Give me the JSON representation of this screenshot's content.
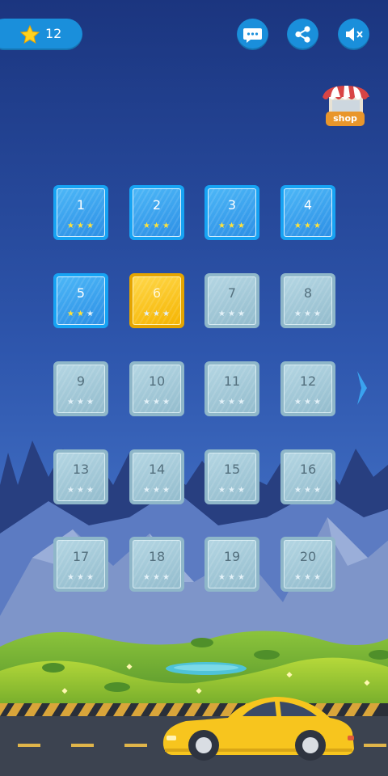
{
  "hud": {
    "star_total": "12"
  },
  "shop": {
    "label": "shop"
  },
  "levels": [
    {
      "number": "1",
      "state": "unlocked",
      "stars": [
        true,
        true,
        true
      ]
    },
    {
      "number": "2",
      "state": "unlocked",
      "stars": [
        true,
        true,
        true
      ]
    },
    {
      "number": "3",
      "state": "unlocked",
      "stars": [
        true,
        true,
        true
      ]
    },
    {
      "number": "4",
      "state": "unlocked",
      "stars": [
        true,
        true,
        true
      ]
    },
    {
      "number": "5",
      "state": "unlocked",
      "stars": [
        true,
        true,
        false
      ]
    },
    {
      "number": "6",
      "state": "current",
      "stars": [
        false,
        false,
        false
      ]
    },
    {
      "number": "7",
      "state": "locked",
      "stars": [
        false,
        false,
        false
      ]
    },
    {
      "number": "8",
      "state": "locked",
      "stars": [
        false,
        false,
        false
      ]
    },
    {
      "number": "9",
      "state": "locked",
      "stars": [
        false,
        false,
        false
      ]
    },
    {
      "number": "10",
      "state": "locked",
      "stars": [
        false,
        false,
        false
      ]
    },
    {
      "number": "11",
      "state": "locked",
      "stars": [
        false,
        false,
        false
      ]
    },
    {
      "number": "12",
      "state": "locked",
      "stars": [
        false,
        false,
        false
      ]
    },
    {
      "number": "13",
      "state": "locked",
      "stars": [
        false,
        false,
        false
      ]
    },
    {
      "number": "14",
      "state": "locked",
      "stars": [
        false,
        false,
        false
      ]
    },
    {
      "number": "15",
      "state": "locked",
      "stars": [
        false,
        false,
        false
      ]
    },
    {
      "number": "16",
      "state": "locked",
      "stars": [
        false,
        false,
        false
      ]
    },
    {
      "number": "17",
      "state": "locked",
      "stars": [
        false,
        false,
        false
      ]
    },
    {
      "number": "18",
      "state": "locked",
      "stars": [
        false,
        false,
        false
      ]
    },
    {
      "number": "19",
      "state": "locked",
      "stars": [
        false,
        false,
        false
      ]
    },
    {
      "number": "20",
      "state": "locked",
      "stars": [
        false,
        false,
        false
      ]
    }
  ],
  "icons": {
    "hud_star": "star-icon",
    "chat": "chat-icon",
    "share": "share-icon",
    "sound": "sound-muted-icon",
    "shop": "shop-stall-icon",
    "next": "chevron-right-icon"
  },
  "colors": {
    "sky_top": "#1d3a8c",
    "sky_bottom": "#4272c9",
    "button_blue": "#1a8fdb",
    "tile_unlocked": "#2d8fe5",
    "tile_current": "#f5b400",
    "tile_locked": "#93bccd",
    "star_earned": "#ffe23a",
    "car_yellow": "#f7c51e"
  }
}
